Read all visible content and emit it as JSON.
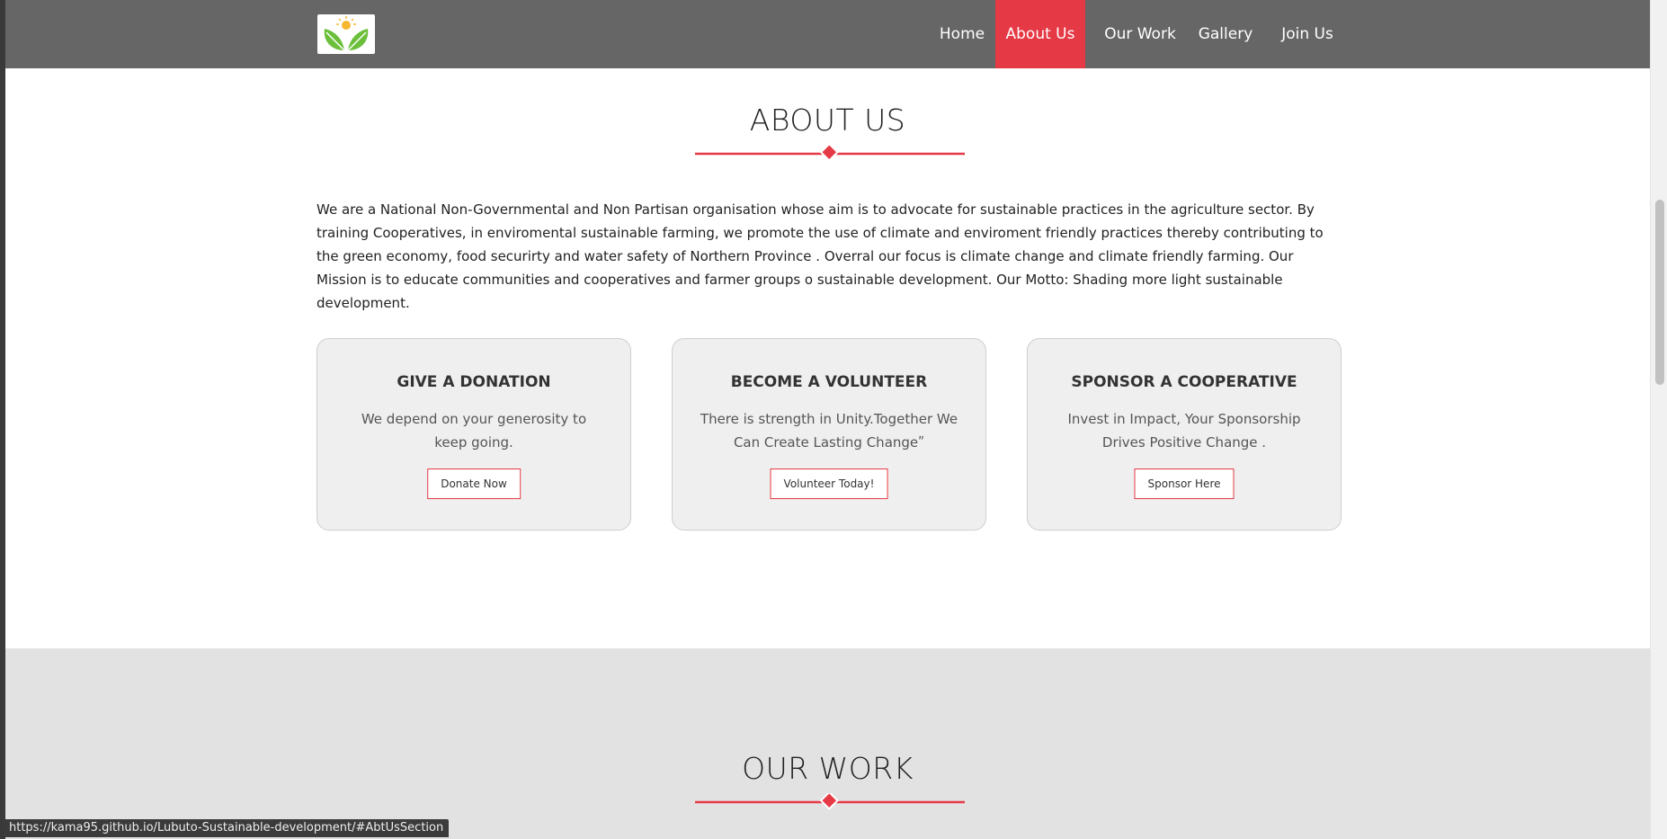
{
  "nav": {
    "items": [
      {
        "label": "Home"
      },
      {
        "label": "About Us",
        "active": true
      },
      {
        "label": "Our Work"
      },
      {
        "label": "Gallery"
      },
      {
        "label": "Join Us"
      }
    ]
  },
  "about": {
    "title": "ABOUT US",
    "text": "We are a National Non-Governmental and Non Partisan organisation whose aim is to advocate for sustainable practices in the agriculture sector. By training Cooperatives, in enviromental sustainable farming, we promote the use of climate and enviroment friendly practices thereby contributing to the green economy, food securirty and water safety of Northern Province . Overral our focus is climate change and climate friendly farming. Our Mission is to educate communities and cooperatives and farmer groups o sustainable development. Our Motto: Shading more light sustainable development.",
    "cards": [
      {
        "title": "GIVE A DONATION",
        "text": "We depend on your generosity to keep going.",
        "button": "Donate Now"
      },
      {
        "title": "BECOME A VOLUNTEER",
        "text": "There is strength in Unity.Together We Can Create Lasting Changeʺ",
        "button": "Volunteer Today!"
      },
      {
        "title": "SPONSOR A COOPERATIVE",
        "text": "Invest in Impact, Your Sponsorship Drives Positive Change .",
        "button": "Sponsor Here"
      }
    ]
  },
  "our_work": {
    "title": "OUR WORK"
  },
  "status_url": "https://kama95.github.io/Lubuto-Sustainable-development/#AbtUsSection",
  "colors": {
    "accent": "#e63946",
    "navbar": "#666666",
    "section_gray": "#e2e2e2"
  }
}
